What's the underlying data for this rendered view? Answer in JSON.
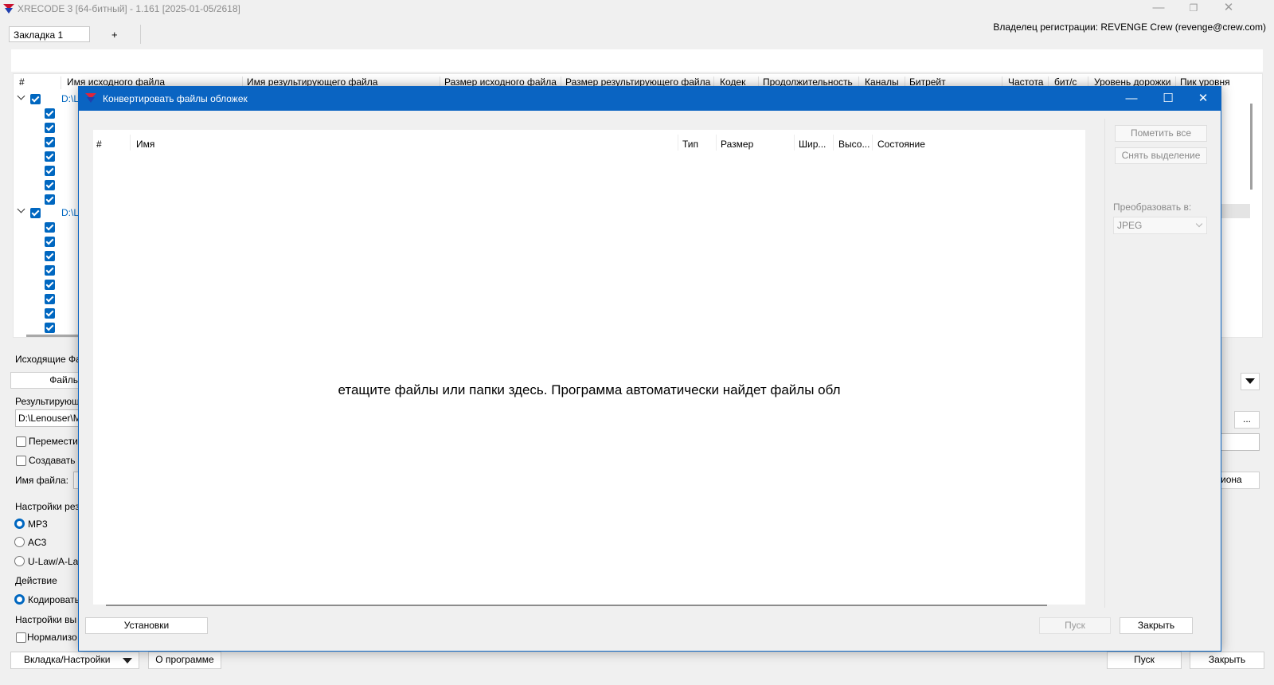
{
  "window": {
    "title": "XRECODE 3 [64-битный] - 1.161 [2025-01-05/2618]",
    "controls": {
      "minimize": "—",
      "maximize": "❐",
      "close": "✕"
    }
  },
  "tabs": {
    "active": "Закладка 1",
    "add": "+"
  },
  "registration": "Владелец регистрации: REVENGE Crew (revenge@crew.com)",
  "file_list": {
    "columns": [
      "#",
      "Имя исходного файла",
      "Имя результирующего файла",
      "Размер исходного файла",
      "Размер результирующего файла",
      "Кодек",
      "Продолжительность",
      "Каналы",
      "Битрейт",
      "Частота",
      "бит/с",
      "Уровень дорожки",
      "Пик уровня"
    ],
    "folder_path_1": "D:\\L",
    "folder_path_2": "D:\\L"
  },
  "left_panel": {
    "source_files_label": "Исходящие Фа",
    "files_button": "Файль",
    "result_label": "Результирующ",
    "result_path": "D:\\Lenouser\\M",
    "move_label": "Переместит",
    "create_label": "Создавать с",
    "filename_label": "Имя файла:",
    "settings_label": "Настройки рез",
    "formats": [
      "MP3",
      "AC3",
      "U-Law/A-La"
    ],
    "action_label": "Действие",
    "action_value": "Кодировать",
    "output_settings_label": "Настройки вы",
    "normalize_label": "Нормализо"
  },
  "right_panel": {
    "browse_button": "...",
    "template_button": "иона"
  },
  "bottom_bar": {
    "tab_settings": "Вкладка/Настройки",
    "about": "О программе",
    "start": "Пуск",
    "close": "Закрыть"
  },
  "dialog": {
    "title": "Конвертировать файлы обложек",
    "controls": {
      "minimize": "—",
      "maximize": "☐",
      "close": "✕"
    },
    "columns": [
      "#",
      "Имя",
      "Тип",
      "Размер",
      "Шир...",
      "Высо...",
      "Состояние"
    ],
    "drop_message": "етащите файлы или папки здесь. Программа автоматически найдет файлы обл",
    "mark_all": "Пометить все",
    "unselect": "Снять выделение",
    "convert_to_label": "Преобразовать в:",
    "format": "JPEG",
    "settings_button": "Установки",
    "start_button": "Пуск",
    "close_button": "Закрыть"
  }
}
